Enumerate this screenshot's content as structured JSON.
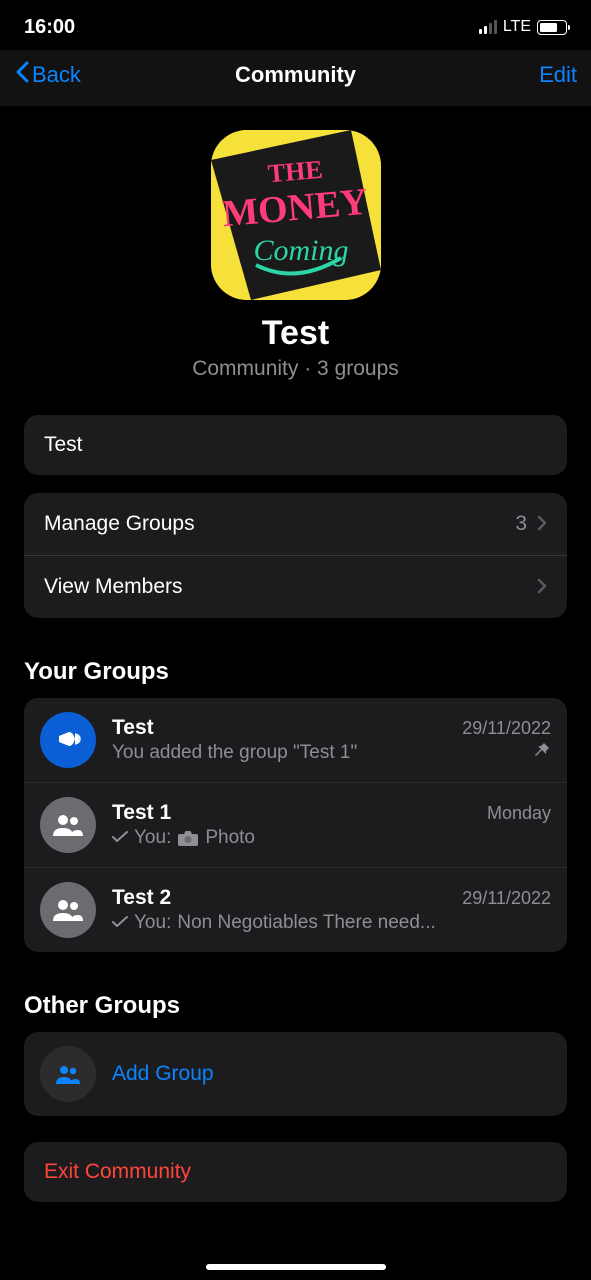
{
  "status": {
    "time": "16:00",
    "network": "LTE"
  },
  "nav": {
    "back_label": "Back",
    "title": "Community",
    "edit_label": "Edit"
  },
  "community": {
    "name": "Test",
    "subtitle": "Community · 3 groups"
  },
  "description": {
    "text": "Test"
  },
  "settings": {
    "manage_label": "Manage Groups",
    "manage_count": "3",
    "view_label": "View Members"
  },
  "your_groups": {
    "title": "Your Groups",
    "items": [
      {
        "name": "Test",
        "date": "29/11/2022",
        "message": "You added the group \"Test 1\"",
        "pinned": true,
        "type": "announce"
      },
      {
        "name": "Test 1",
        "date": "Monday",
        "prefix": "You:",
        "message": "Photo",
        "has_tick": true,
        "has_camera": true,
        "type": "group"
      },
      {
        "name": "Test 2",
        "date": "29/11/2022",
        "prefix": "You:",
        "message": "Non Negotiables There need...",
        "has_tick": true,
        "type": "group"
      }
    ]
  },
  "other_groups": {
    "title": "Other Groups",
    "add_label": "Add Group"
  },
  "exit": {
    "label": "Exit Community"
  }
}
